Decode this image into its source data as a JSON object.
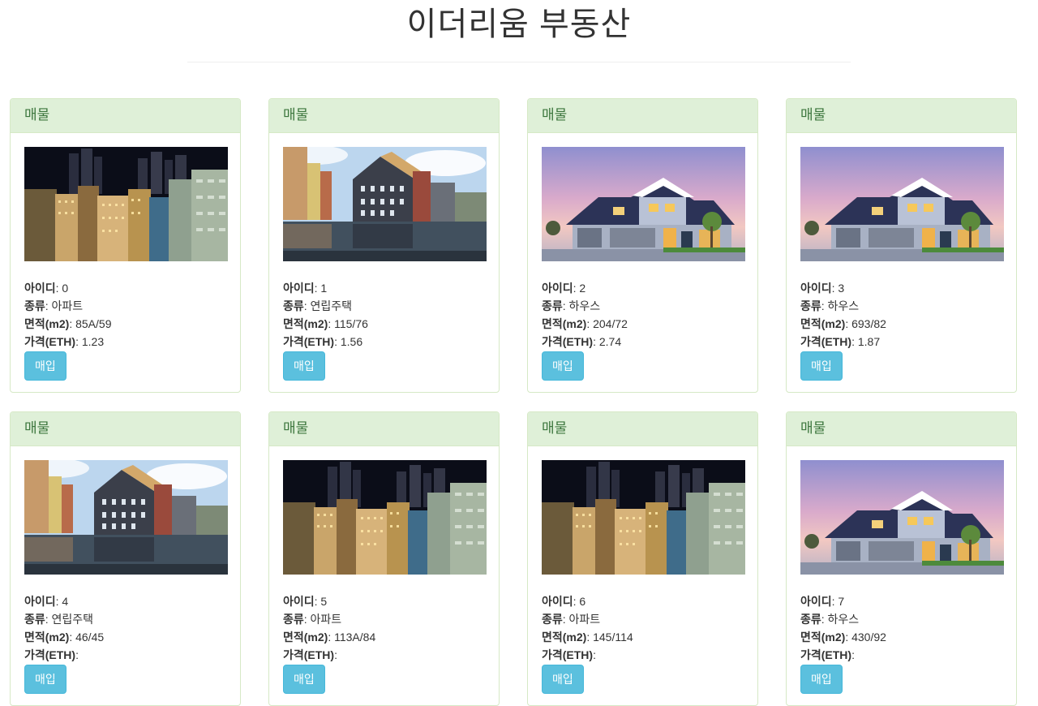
{
  "page": {
    "title": "이더리움 부동산"
  },
  "labels": {
    "card_header": "매물",
    "id": "아이디",
    "type": "종류",
    "area": "면적(m2)",
    "price": "가격(ETH)",
    "buy": "매입"
  },
  "listings": [
    {
      "id": "0",
      "type": "아파트",
      "area": "85A/59",
      "price": "1.23",
      "image": "city-image"
    },
    {
      "id": "1",
      "type": "연립주택",
      "area": "115/76",
      "price": "1.56",
      "image": "canal-image"
    },
    {
      "id": "2",
      "type": "하우스",
      "area": "204/72",
      "price": "2.74",
      "image": "house-image"
    },
    {
      "id": "3",
      "type": "하우스",
      "area": "693/82",
      "price": "1.87",
      "image": "house-image"
    },
    {
      "id": "4",
      "type": "연립주택",
      "area": "46/45",
      "price": "",
      "image": "canal-image"
    },
    {
      "id": "5",
      "type": "아파트",
      "area": "113A/84",
      "price": "",
      "image": "city-image"
    },
    {
      "id": "6",
      "type": "아파트",
      "area": "145/114",
      "price": "",
      "image": "city-image"
    },
    {
      "id": "7",
      "type": "하우스",
      "area": "430/92",
      "price": "",
      "image": "house-image"
    }
  ]
}
